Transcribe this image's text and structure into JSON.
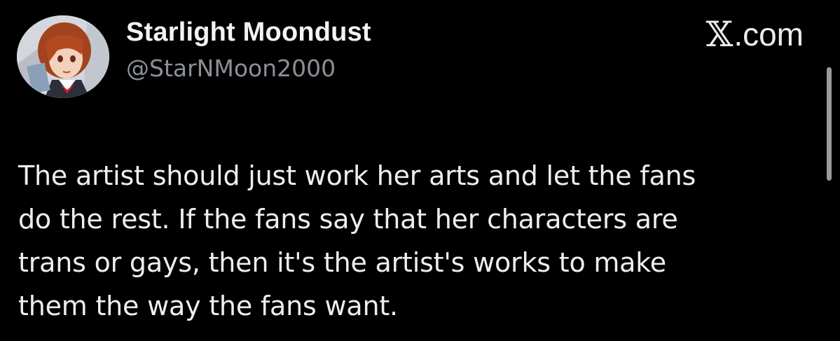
{
  "author": {
    "display_name": "Starlight Moondust",
    "handle": "@StarNMoon2000",
    "avatar_icon": "anime-character-avatar"
  },
  "source": {
    "logo_icon": "x-logo-icon",
    "logo_glyph": "𝕏",
    "domain_suffix": ".com"
  },
  "tweet": {
    "lines": [
      "The artist should just work her arts and let the fans",
      "do the rest. If the fans say that her characters are",
      "trans or gays, then it's the artist's works to make",
      "them the way the fans want."
    ]
  },
  "colors": {
    "background": "#000000",
    "text_primary": "#eeeeee",
    "text_secondary": "#8b9096",
    "scrollbar": "#9a9a9a"
  }
}
